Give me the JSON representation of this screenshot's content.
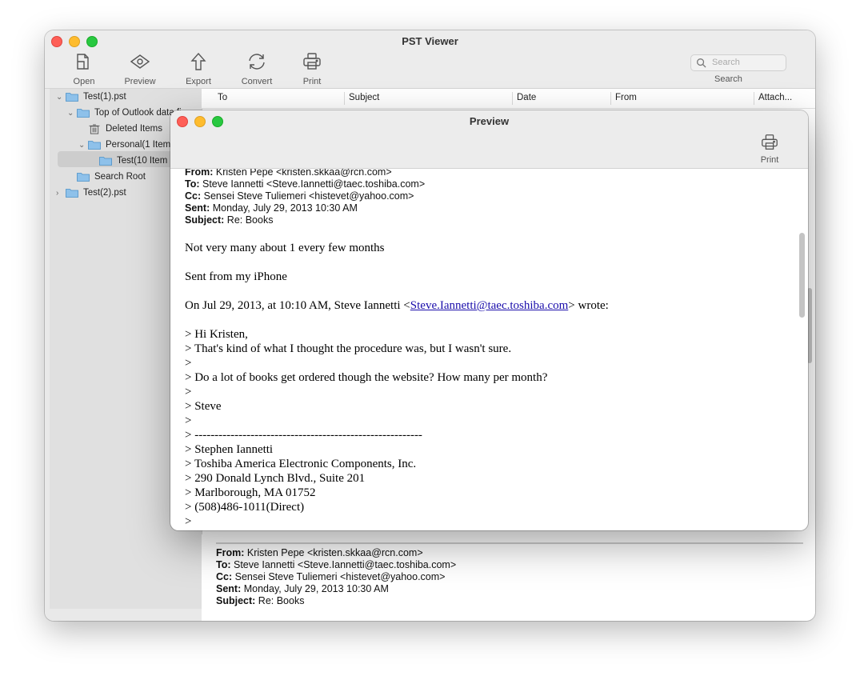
{
  "main_window": {
    "title": "PST Viewer",
    "toolbar": [
      {
        "label": "Open",
        "icon": "open-file-icon"
      },
      {
        "label": "Preview",
        "icon": "eye-icon"
      },
      {
        "label": "Export",
        "icon": "export-arrow-icon"
      },
      {
        "label": "Convert",
        "icon": "convert-arrows-icon"
      },
      {
        "label": "Print",
        "icon": "printer-icon"
      }
    ],
    "search": {
      "placeholder": "Search",
      "label": "Search"
    }
  },
  "sidebar": {
    "items": [
      {
        "label": "Test(1).pst",
        "expanded": true
      },
      {
        "label": "Top of Outlook data fi",
        "expanded": true
      },
      {
        "label": "Deleted Items"
      },
      {
        "label": "Personal(1 Item",
        "expanded": true
      },
      {
        "label": "Test(10 Item",
        "selected": true
      },
      {
        "label": "Search Root"
      },
      {
        "label": "Test(2).pst",
        "expanded": false
      }
    ]
  },
  "table": {
    "columns": [
      "To",
      "Subject",
      "Date",
      "From",
      "Attach..."
    ]
  },
  "bottom_preview": {
    "from_label": "From:",
    "from": "Kristen Pepe <kristen.skkaa@rcn.com>",
    "to_label": "To:",
    "to": "Steve Iannetti <Steve.Iannetti@taec.toshiba.com>",
    "cc_label": "Cc:",
    "cc": "Sensei Steve Tuliemeri <histevet@yahoo.com>",
    "sent_label": "Sent:",
    "sent": "Monday, July 29, 2013 10:30 AM",
    "subject_label": "Subject:",
    "subject": "Re: Books"
  },
  "preview_window": {
    "title": "Preview",
    "print_label": "Print",
    "header": {
      "from_label": "From:",
      "from": "Kristen Pepe <kristen.skkaa@rcn.com>",
      "to_label": "To:",
      "to": "Steve Iannetti <Steve.Iannetti@taec.toshiba.com>",
      "cc_label": "Cc:",
      "cc": "Sensei Steve Tuliemeri <histevet@yahoo.com>",
      "sent_label": "Sent:",
      "sent": "Monday, July 29, 2013 10:30 AM",
      "subject_label": "Subject:",
      "subject": "Re: Books"
    },
    "body": {
      "line1": "Not very many about 1 every few months",
      "line2": "Sent from my iPhone",
      "wrote_prefix": "On Jul 29, 2013, at 10:10 AM, Steve Iannetti <",
      "wrote_link": "Steve.Iannetti@taec.toshiba.com",
      "wrote_suffix": "> wrote:",
      "quoted": [
        "> Hi Kristen,",
        "> That's kind of what I thought the procedure was, but I wasn't sure.",
        ">",
        "> Do a lot of books get ordered though the website? How many per month?",
        ">",
        "> Steve",
        ">",
        "> ---------------------------------------------------------",
        "> Stephen Iannetti",
        "> Toshiba America Electronic Components, Inc.",
        "> 290 Donald Lynch Blvd., Suite 201",
        "> Marlborough, MA 01752",
        "> (508)486-1011(Direct)",
        ">"
      ]
    }
  }
}
